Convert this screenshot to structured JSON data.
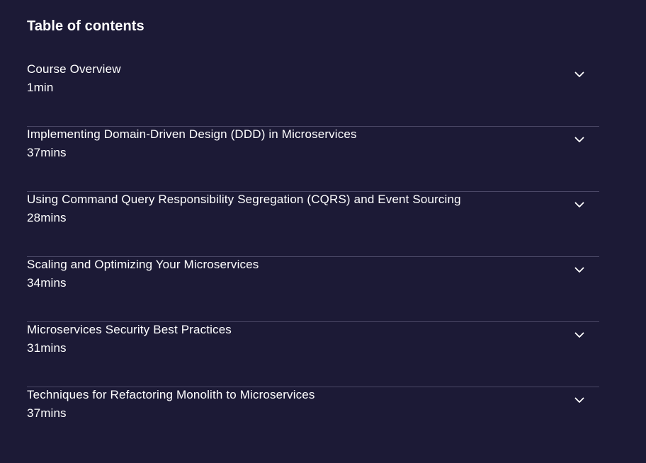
{
  "toc": {
    "title": "Table of contents",
    "modules": [
      {
        "name": "Course Overview",
        "duration": "1min",
        "icon": "chevron-down-icon"
      },
      {
        "name": "Implementing Domain-Driven Design (DDD) in Microservices",
        "duration": "37mins",
        "icon": "chevron-down-icon"
      },
      {
        "name": "Using Command Query Responsibility Segregation (CQRS) and Event Sourcing",
        "duration": "28mins",
        "icon": "chevron-down-icon"
      },
      {
        "name": "Scaling and Optimizing Your Microservices",
        "duration": "34mins",
        "icon": "chevron-down-icon"
      },
      {
        "name": "Microservices Security Best Practices",
        "duration": "31mins",
        "icon": "chevron-down-icon"
      },
      {
        "name": "Techniques for Refactoring Monolith to Microservices",
        "duration": "37mins",
        "icon": "chevron-down-icon"
      }
    ]
  },
  "colors": {
    "background": "#1c1a36",
    "text": "#ffffff",
    "divider": "#4a4766"
  }
}
